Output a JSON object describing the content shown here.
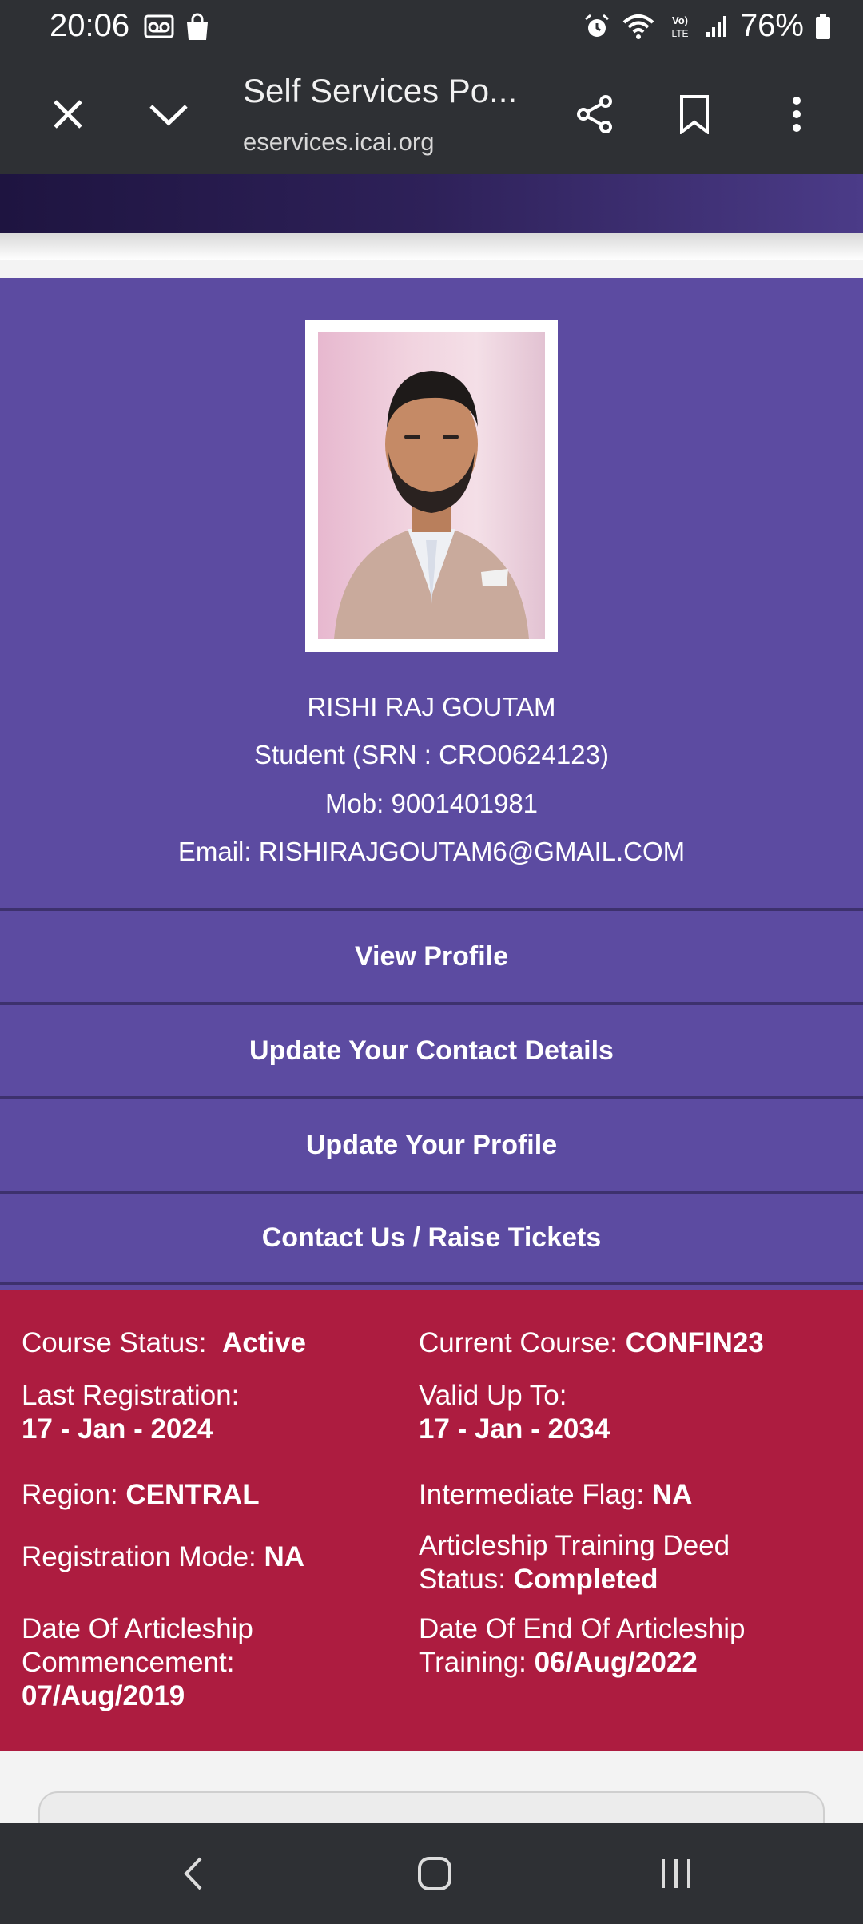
{
  "status_bar": {
    "time": "20:06",
    "battery": "76%",
    "icons": [
      "voicemail-icon",
      "shopping-bag-icon",
      "alarm-icon",
      "wifi-icon",
      "volte-icon",
      "signal-icon",
      "battery-icon"
    ]
  },
  "browser_toolbar": {
    "title": "Self Services Po...",
    "url": "eservices.icai.org",
    "icons": [
      "close-icon",
      "chevron-down-icon",
      "share-icon",
      "bookmark-icon",
      "more-vert-icon"
    ]
  },
  "profile": {
    "name": "RISHI RAJ GOUTAM",
    "role_line": "Student (SRN : CRO0624123)",
    "mobile_line": "Mob: 9001401981",
    "email_line": "Email: RISHIRAJGOUTAM6@GMAIL.COM"
  },
  "menu": {
    "items": [
      {
        "label": "View Profile"
      },
      {
        "label": "Update Your Contact Details"
      },
      {
        "label": "Update Your Profile"
      },
      {
        "label": "Contact Us / Raise Tickets"
      }
    ]
  },
  "course": {
    "course_status": {
      "label": "Course Status:",
      "value": "Active"
    },
    "current_course": {
      "label": "Current Course:",
      "value": "CONFIN23"
    },
    "last_registration": {
      "label": "Last Registration:",
      "value": "17 - Jan - 2024"
    },
    "valid_up_to": {
      "label": "Valid Up To:",
      "value": "17 - Jan - 2034"
    },
    "region": {
      "label": "Region:",
      "value": "CENTRAL"
    },
    "intermediate_flag": {
      "label": "Intermediate Flag:",
      "value": "NA"
    },
    "registration_mode": {
      "label": "Registration Mode:",
      "value": "NA"
    },
    "deed_status": {
      "label_line1": "Articleship Training Deed",
      "label_line2": "Status:",
      "value": "Completed"
    },
    "articleship_commencement": {
      "label_line1": "Date Of Articleship",
      "label_line2": "Commencement:",
      "value": "07/Aug/2019"
    },
    "articleship_end": {
      "label_line1": "Date Of End Of Articleship",
      "label_line2": "Training:",
      "value": "06/Aug/2022"
    }
  },
  "colors": {
    "browser_chrome": "#2e3034",
    "profile_bg": "#5c4ba1",
    "course_bg": "#ad1c40"
  }
}
